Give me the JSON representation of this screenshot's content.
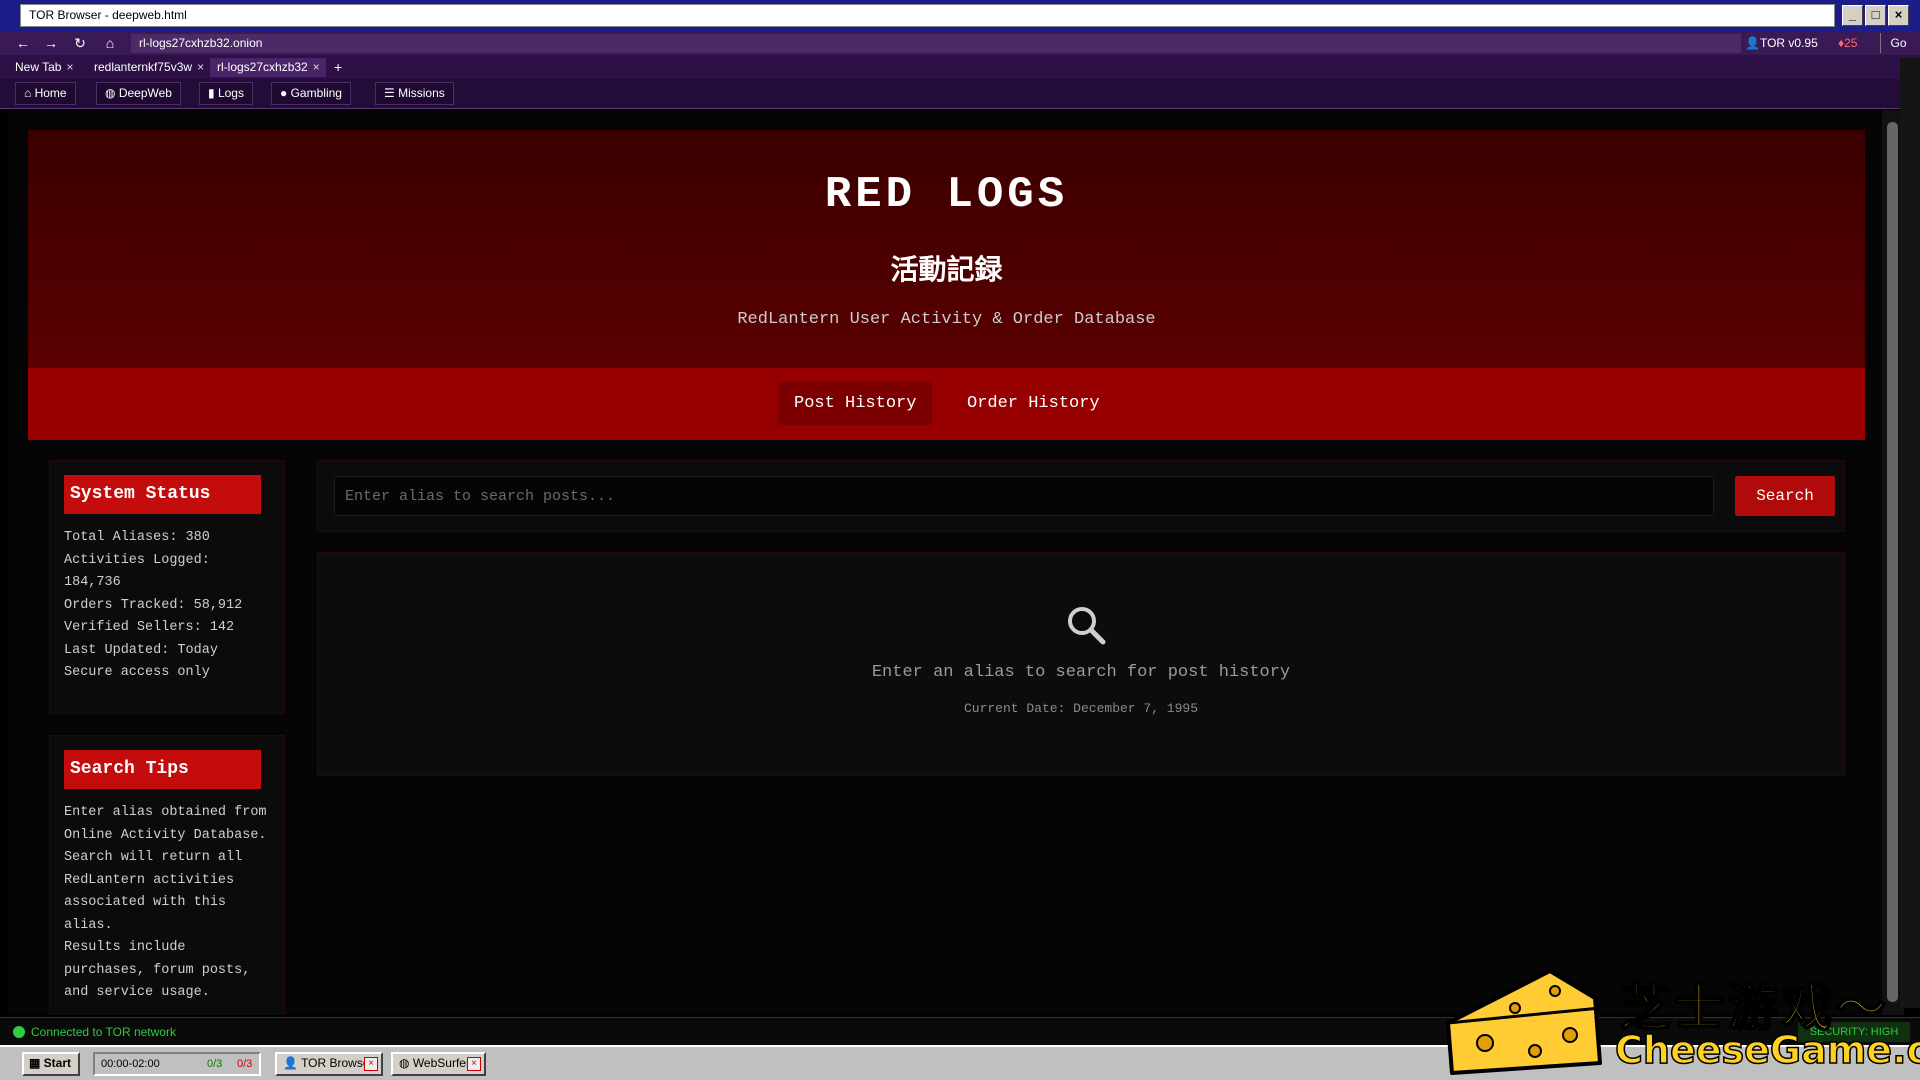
{
  "window": {
    "title": "TOR Browser - deepweb.html"
  },
  "addressbar": {
    "url": "rl-logs27cxhzb32.onion",
    "tor_version": "TOR v0.95",
    "alert_count": "25",
    "go_label": "Go"
  },
  "tabs": [
    {
      "label": "New Tab"
    },
    {
      "label": "redlanternkf75v3w"
    },
    {
      "label": "rl-logs27cxhzb32"
    }
  ],
  "bookmarks": [
    {
      "label": "Home"
    },
    {
      "label": "DeepWeb"
    },
    {
      "label": "Logs"
    },
    {
      "label": "Gambling"
    },
    {
      "label": "Missions"
    }
  ],
  "site": {
    "title": "RED LOGS",
    "subtitle_cn": "活動記録",
    "tagline": "RedLantern User Activity & Order Database"
  },
  "nav": [
    {
      "label": "Post History"
    },
    {
      "label": "Order History"
    }
  ],
  "system_status": {
    "title": "System Status",
    "lines": [
      "Total Aliases: 380",
      "Activities Logged: 184,736",
      "Orders Tracked: 58,912",
      "Verified Sellers: 142",
      "Last Updated: Today",
      "Secure access only"
    ]
  },
  "search_tips": {
    "title": "Search Tips",
    "lines": [
      "Enter alias obtained from Online Activity Database.",
      "Search will return all RedLantern activities associated with this alias.",
      "Results include purchases, forum posts, and service usage."
    ]
  },
  "search": {
    "placeholder": "Enter alias to search posts...",
    "button": "Search"
  },
  "results": {
    "message": "Enter an alias to search for post history",
    "date": "Current Date: December 7, 1995"
  },
  "statusbar": {
    "connection": "Connected to TOR network",
    "security": "SECURITY: HIGH"
  },
  "taskbar": {
    "start": "Start",
    "timer": "00:00-02:00",
    "counter_a": "0/3",
    "counter_b": "0/3",
    "items": [
      {
        "label": "TOR Browser"
      },
      {
        "label": "WebSurfer"
      }
    ]
  },
  "watermark": {
    "cn": "芝士游戏～",
    "en": "CheeseGame.org"
  },
  "colors": {
    "header_red": "#5a0000",
    "nav_red": "#970000",
    "accent_red": "#c40c0c",
    "online_green": "#2ecc40"
  }
}
